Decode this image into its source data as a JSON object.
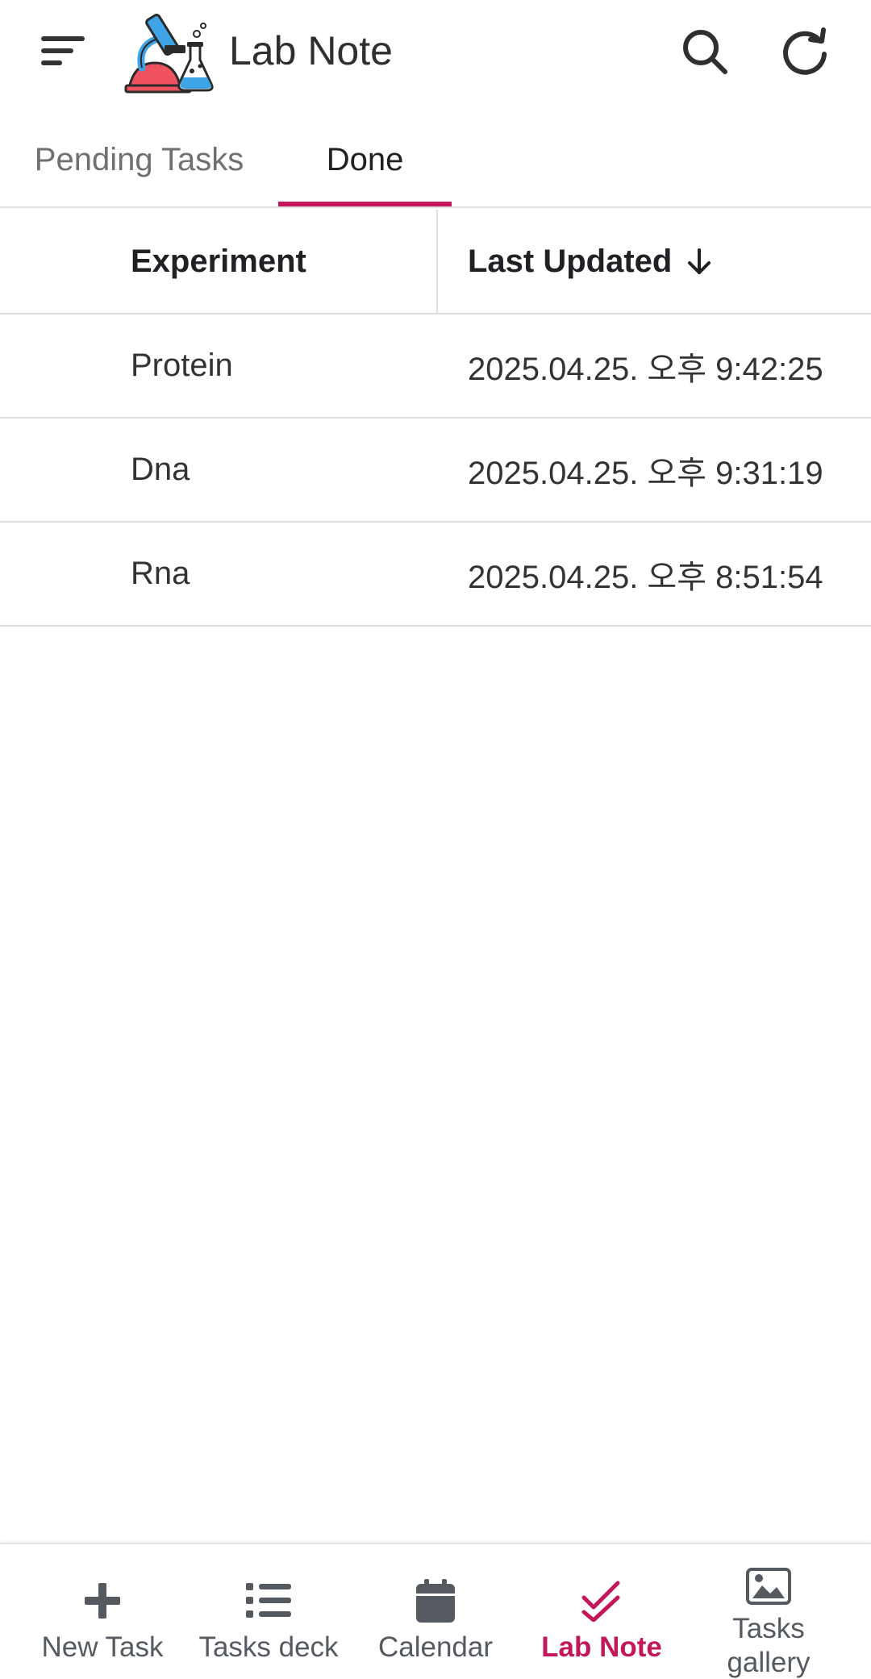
{
  "app": {
    "title": "Lab Note"
  },
  "tabs": [
    {
      "label": "Pending Tasks",
      "active": false
    },
    {
      "label": "Done",
      "active": true
    }
  ],
  "table": {
    "columns": {
      "experiment": "Experiment",
      "last_updated": "Last Updated"
    },
    "sort": {
      "column": "last_updated",
      "direction": "descending"
    },
    "rows": [
      {
        "experiment": "Protein",
        "last_updated": "2025.04.25. 오후 9:42:25"
      },
      {
        "experiment": "Dna",
        "last_updated": "2025.04.25. 오후 9:31:19"
      },
      {
        "experiment": "Rna",
        "last_updated": "2025.04.25. 오후 8:51:54"
      }
    ]
  },
  "bottom_nav": [
    {
      "label": "New Task",
      "icon": "plus-icon",
      "active": false
    },
    {
      "label": "Tasks deck",
      "icon": "list-icon",
      "active": false
    },
    {
      "label": "Calendar",
      "icon": "calendar-icon",
      "active": false
    },
    {
      "label": "Lab Note",
      "icon": "check-icon",
      "active": true
    },
    {
      "label": "Tasks gallery",
      "icon": "image-icon",
      "active": false
    }
  ],
  "colors": {
    "accent": "#c2185b",
    "icon_gray": "#5f6368",
    "divider": "#dedede"
  }
}
